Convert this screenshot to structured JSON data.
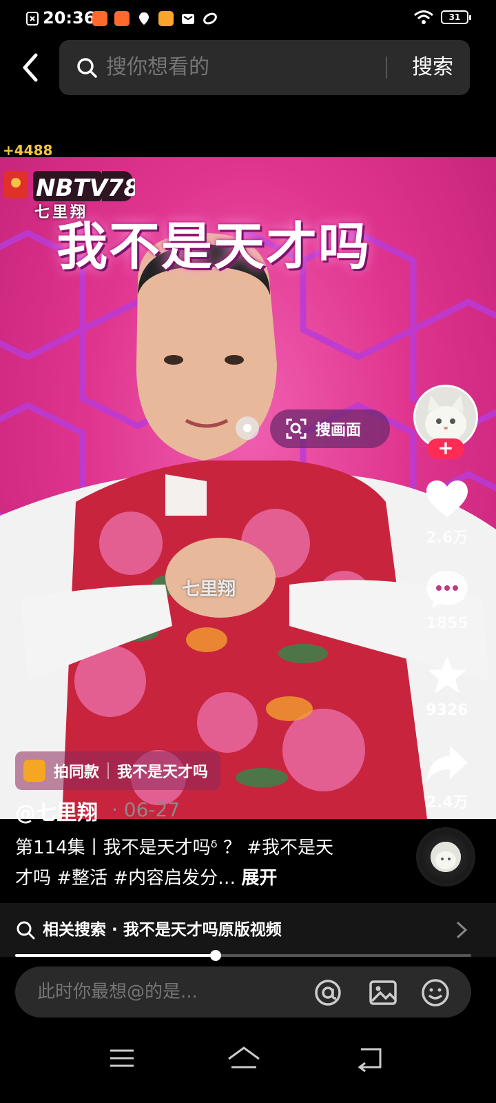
{
  "status_bar": {
    "time": "20:36",
    "battery": "31"
  },
  "search": {
    "placeholder": "搜你想看的",
    "button_label": "搜索"
  },
  "coins_badge": "+4488",
  "video": {
    "channel_logo_text": "NBTV78",
    "channel_subtitle": "七里翔",
    "title_overlay": "我不是天才吗",
    "watermark": "七里翔",
    "scan_label": "搜画面",
    "same_style": {
      "label": "拍同款",
      "song": "我不是天才吗"
    }
  },
  "rail": {
    "follow_label": "+",
    "likes": "2.6万",
    "comments": "1855",
    "favorites": "9326",
    "shares": "2.4万"
  },
  "post": {
    "author": "@七里翔",
    "date": "· 06-27",
    "description": "第114集丨我不是天才吗ᵟ ？ #我不是天才吗 #整活 #内容启发分… ",
    "expand_label": "展开"
  },
  "related_search": {
    "label": "相关搜索 · 我不是天才吗原版视频"
  },
  "playback": {
    "progress": 0.44
  },
  "comment": {
    "placeholder": "此时你最想@的是..."
  },
  "colors": {
    "accent": "#fe2c55",
    "video_bg": "#e0358f",
    "coins": "#f5c542"
  }
}
